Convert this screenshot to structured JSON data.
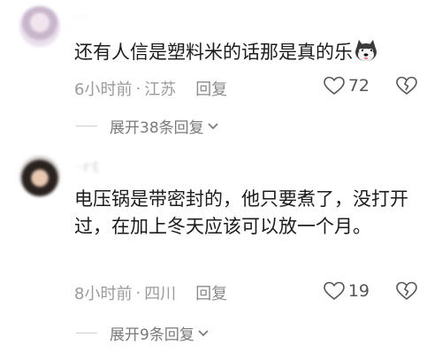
{
  "comments": [
    {
      "username": "· ·",
      "text": "还有人信是塑料米的话那是真的乐",
      "emoji": "doge-emoji",
      "time": "6小时前",
      "location": "江苏",
      "reply_label": "回复",
      "likes": "72",
      "expand_label": "展开38条回复"
    },
    {
      "username": "··ℓ'ξ",
      "text": "电压锅是带密封的，他只要煮了，没打开过，在加上冬天应该可以放一个月。",
      "time": "8小时前",
      "location": "四川",
      "reply_label": "回复",
      "likes": "19",
      "expand_label": "展开9条回复"
    }
  ],
  "separator": "·"
}
